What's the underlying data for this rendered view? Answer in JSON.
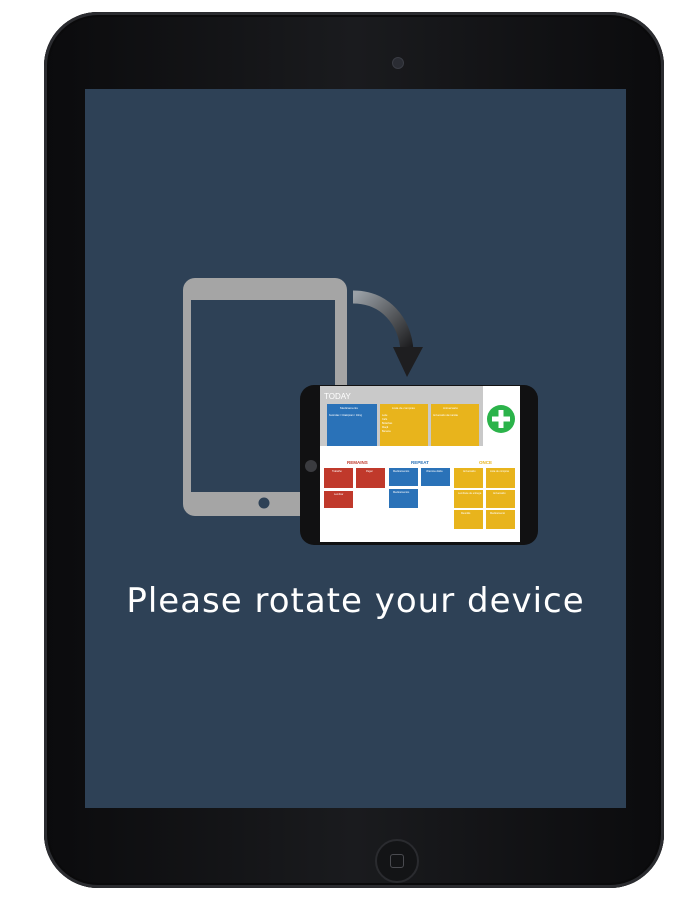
{
  "screen": {
    "message": "Please rotate your device",
    "background_color": "#2e4156"
  },
  "icons": {
    "device": "ipad-frame",
    "rotate": "curved-arrow",
    "add": "plus-icon"
  },
  "preview": {
    "header": "TODAY",
    "today_cards": [
      {
        "title": "Medicaments",
        "body": "Ketorolac / Citalopram / 10mg",
        "color": "#2a72b8"
      },
      {
        "title": "Lista de compras",
        "body": "Leite\nCafé\nBolachas\nMaçã\nBanana",
        "color": "#e8b41c"
      },
      {
        "title": "Aniversario",
        "body": "Aniversário da mamãe para a mamãe",
        "color": "#e8b41c"
      }
    ],
    "sections": [
      "REMAINS",
      "REPEAT",
      "ONCE"
    ],
    "section_colors": [
      "#c0392b",
      "#2a72b8",
      "#e8b41c"
    ]
  }
}
